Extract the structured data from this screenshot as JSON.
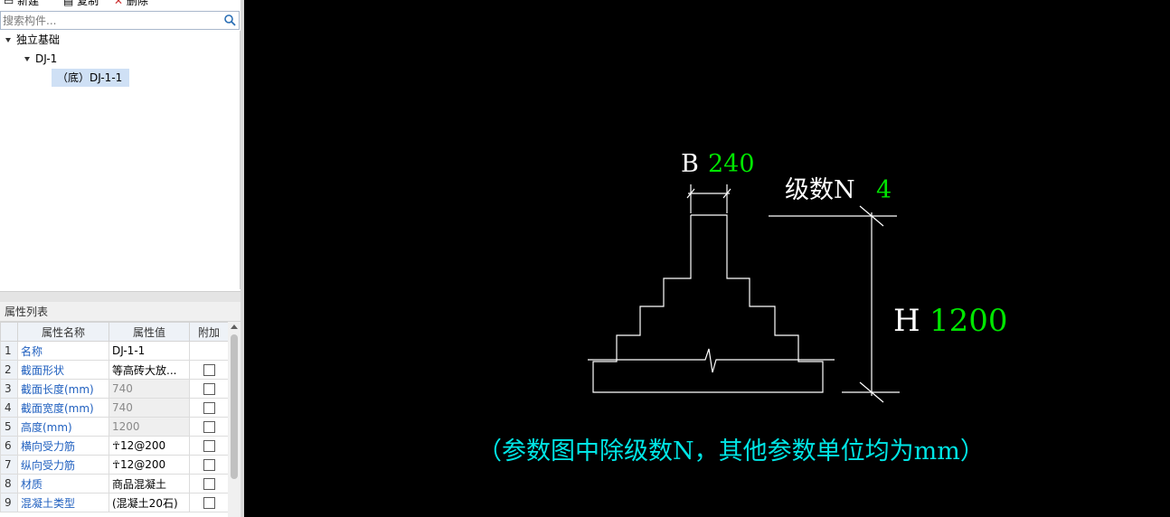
{
  "toolbar": {
    "new_label": "新建",
    "copy_label": "复制",
    "delete_label": "删除"
  },
  "search": {
    "placeholder": "搜索构件..."
  },
  "tree": {
    "root": "独立基础",
    "child": "DJ-1",
    "leaf": "（底）DJ-1-1"
  },
  "props": {
    "title": "属性列表",
    "headers": [
      "",
      "属性名称",
      "属性值",
      "附加"
    ],
    "rows": [
      {
        "n": "1",
        "name": "名称",
        "value": "DJ-1-1",
        "checkbox": false
      },
      {
        "n": "2",
        "name": "截面形状",
        "value": "等高砖大放...",
        "checkbox": true
      },
      {
        "n": "3",
        "name": "截面长度(mm)",
        "value": "740",
        "checkbox": true,
        "disabled": true
      },
      {
        "n": "4",
        "name": "截面宽度(mm)",
        "value": "740",
        "checkbox": true,
        "disabled": true
      },
      {
        "n": "5",
        "name": "高度(mm)",
        "value": "1200",
        "checkbox": true,
        "disabled": true
      },
      {
        "n": "6",
        "name": "横向受力筋",
        "value": "☥12@200",
        "checkbox": true
      },
      {
        "n": "7",
        "name": "纵向受力筋",
        "value": "☥12@200",
        "checkbox": true
      },
      {
        "n": "8",
        "name": "材质",
        "value": "商品混凝土",
        "checkbox": true
      },
      {
        "n": "9",
        "name": "混凝土类型",
        "value": "(混凝土20石)",
        "checkbox": true
      }
    ]
  },
  "drawing": {
    "b_label": "B",
    "b_value": "240",
    "n_label": "级数N",
    "n_value": "4",
    "h_label": "H",
    "h_value": "1200",
    "note": "（参数图中除级数N，其他参数单位均为mm）",
    "colors": {
      "line": "#ffffff",
      "value": "#00e600",
      "note": "#00e5e5"
    }
  }
}
